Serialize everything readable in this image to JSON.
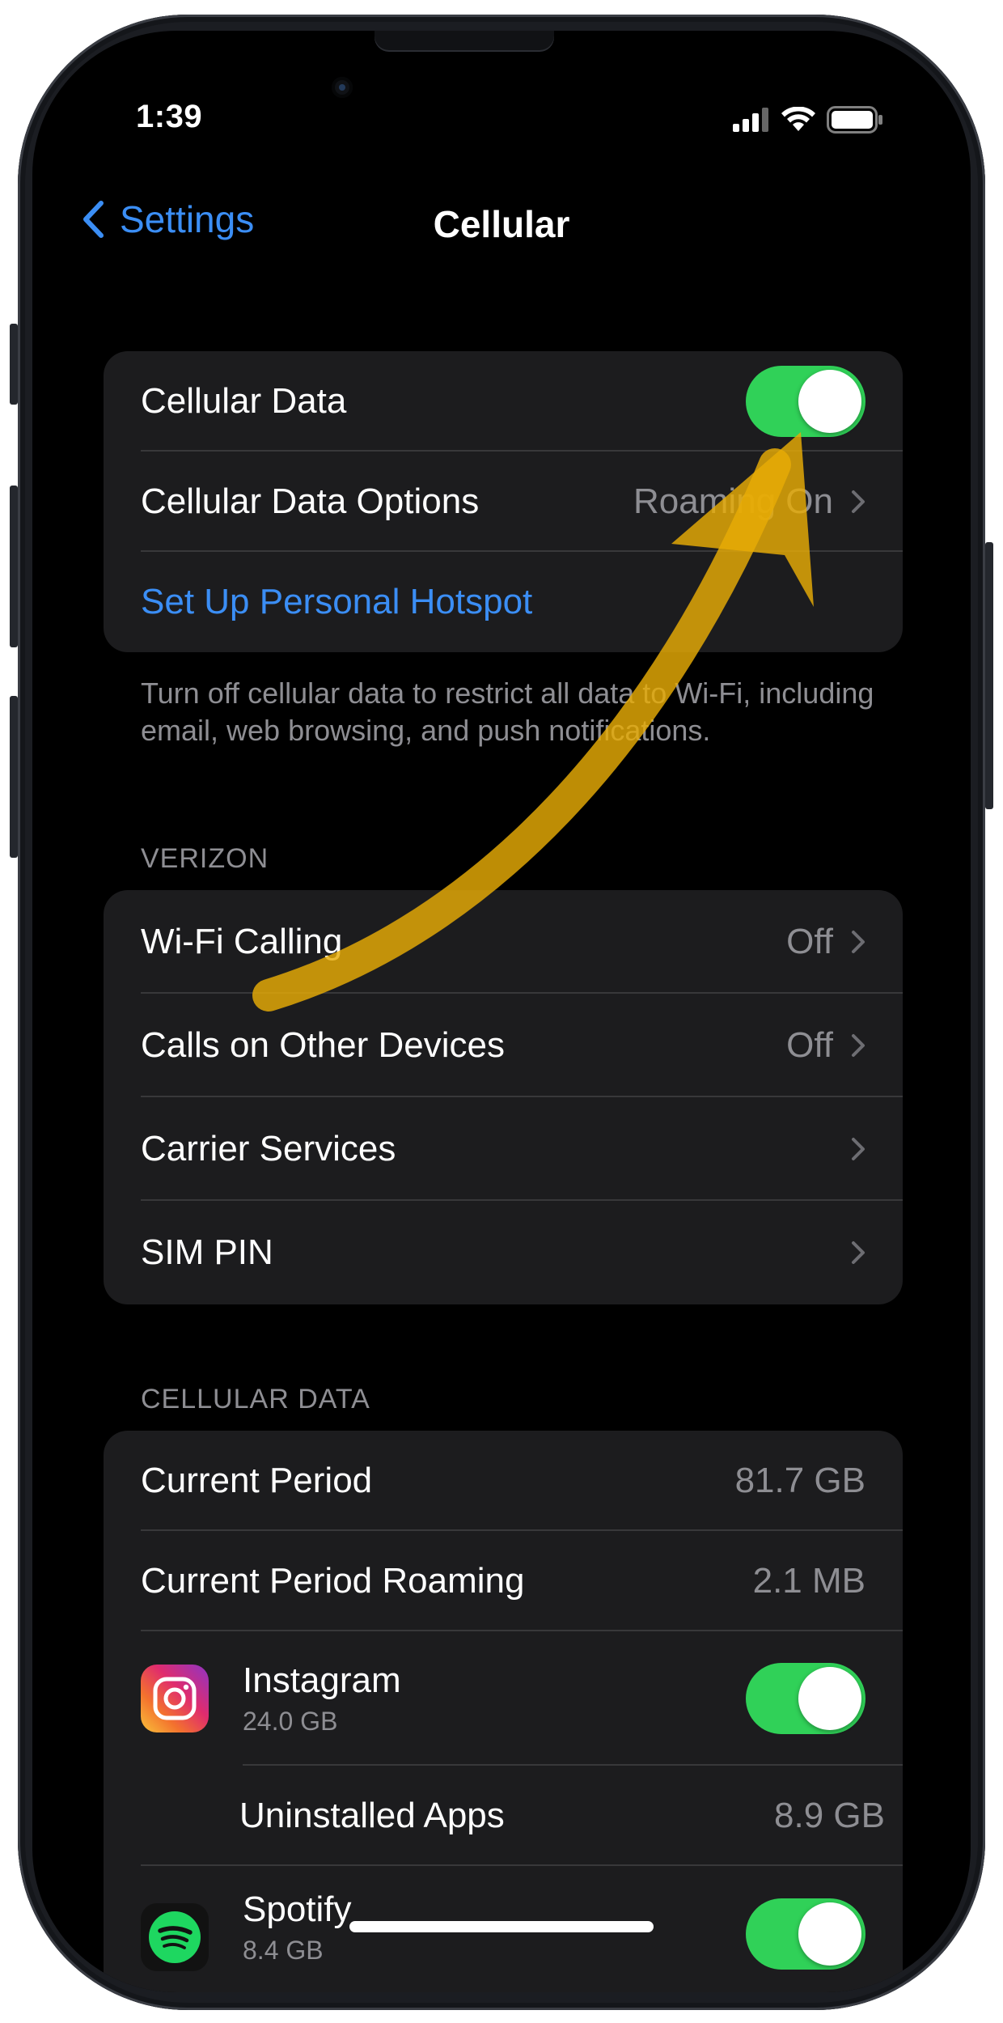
{
  "status_bar": {
    "time": "1:39"
  },
  "nav": {
    "back_label": "Settings",
    "title": "Cellular"
  },
  "group1": {
    "cellular_data_label": "Cellular Data",
    "cellular_data_on": true,
    "options_label": "Cellular Data Options",
    "options_value": "Roaming On",
    "hotspot_label": "Set Up Personal Hotspot"
  },
  "group1_footer": "Turn off cellular data to restrict all data to Wi-Fi, including email, web browsing, and push notifications.",
  "carrier": {
    "header": "VERIZON",
    "rows": [
      {
        "label": "Wi-Fi Calling",
        "value": "Off"
      },
      {
        "label": "Calls on Other Devices",
        "value": "Off"
      },
      {
        "label": "Carrier Services",
        "value": ""
      },
      {
        "label": "SIM PIN",
        "value": ""
      }
    ]
  },
  "usage": {
    "header": "CELLULAR DATA",
    "current_period_label": "Current Period",
    "current_period_value": "81.7 GB",
    "roaming_label": "Current Period Roaming",
    "roaming_value": "2.1 MB",
    "apps": [
      {
        "name": "Instagram",
        "size": "24.0 GB",
        "icon": "instagram-icon",
        "enabled": true
      },
      {
        "name": "Spotify",
        "size": "8.4 GB",
        "icon": "spotify-icon",
        "enabled": true
      }
    ],
    "uninstalled_label": "Uninstalled Apps",
    "uninstalled_value": "8.9 GB"
  },
  "colors": {
    "accent": "#3b8ef5",
    "toggle_on": "#30d158",
    "cell_background": "#1c1c1e",
    "annotation_arrow": "#f2b705"
  }
}
